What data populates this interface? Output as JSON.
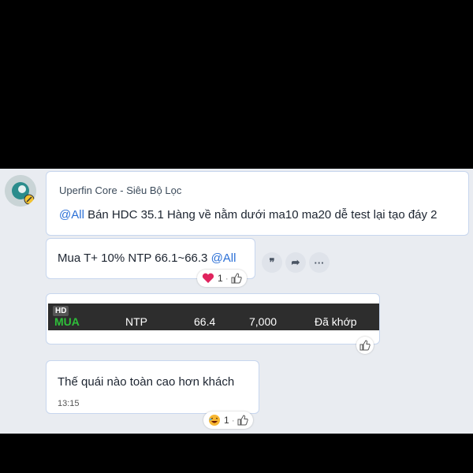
{
  "messages": {
    "first": {
      "sender": "Uperfin Core - Siêu Bộ Lọc",
      "mention": "@All",
      "text": " Bán HDC 35.1 Hàng về nằm dưới ma10 ma20 dễ test lại tạo đáy 2"
    },
    "second": {
      "text": "Mua T+ 10% NTP 66.1~66.3 ",
      "mention": "@All",
      "reaction": {
        "icon": "heart-icon",
        "count": "1",
        "like_icon": "thumbs-up-icon"
      },
      "actions": [
        {
          "label": "❞",
          "icon": "quote-icon"
        },
        {
          "label": "➦",
          "icon": "forward-icon"
        },
        {
          "label": "···",
          "icon": "more-icon"
        }
      ]
    },
    "order": {
      "badge": "HD",
      "side": "MUA",
      "symbol": "NTP",
      "price": "66.4",
      "quantity": "7,000",
      "status": "Đã khớp",
      "side_color": "#2fbf3a"
    },
    "fourth": {
      "text": "Thế quái nào toàn cao hơn khách",
      "time": "13:15",
      "reaction": {
        "icon": "laughing-face-icon",
        "count": "1",
        "like_icon": "thumbs-up-icon"
      }
    }
  },
  "colors": {
    "mention": "#2a6fd6",
    "bubble_border": "#c7d6ee",
    "chat_bg": "#e9ecf1"
  }
}
